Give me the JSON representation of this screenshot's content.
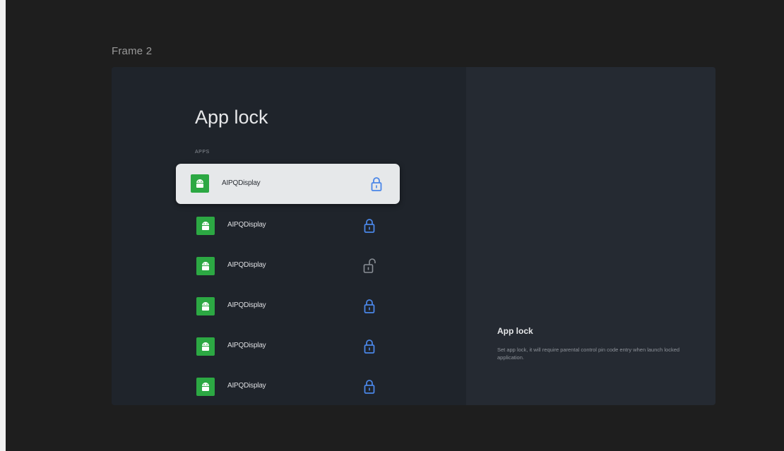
{
  "frame": {
    "label": "Frame 2"
  },
  "left": {
    "title": "App lock",
    "section_label": "APPS",
    "items": [
      {
        "name": "AIPQDisplay",
        "locked": true,
        "icon": "lock-icon",
        "selected": true
      },
      {
        "name": "AIPQDisplay",
        "locked": true,
        "icon": "lock-icon",
        "selected": false
      },
      {
        "name": "AIPQDisplay",
        "locked": false,
        "icon": "unlock-icon",
        "selected": false
      },
      {
        "name": "AIPQDisplay",
        "locked": true,
        "icon": "lock-icon",
        "selected": false
      },
      {
        "name": "AIPQDisplay",
        "locked": true,
        "icon": "lock-icon",
        "selected": false
      },
      {
        "name": "AIPQDisplay",
        "locked": true,
        "icon": "lock-icon",
        "selected": false
      }
    ]
  },
  "right": {
    "title": "App lock",
    "description": "Set app lock, it will require parental control pin code entry when launch locked application."
  },
  "colors": {
    "lock_blue": "#4a86e8",
    "unlock_grey": "#8a8f96",
    "android_green": "#2ca843",
    "selected_bg": "#e6e8ea"
  }
}
